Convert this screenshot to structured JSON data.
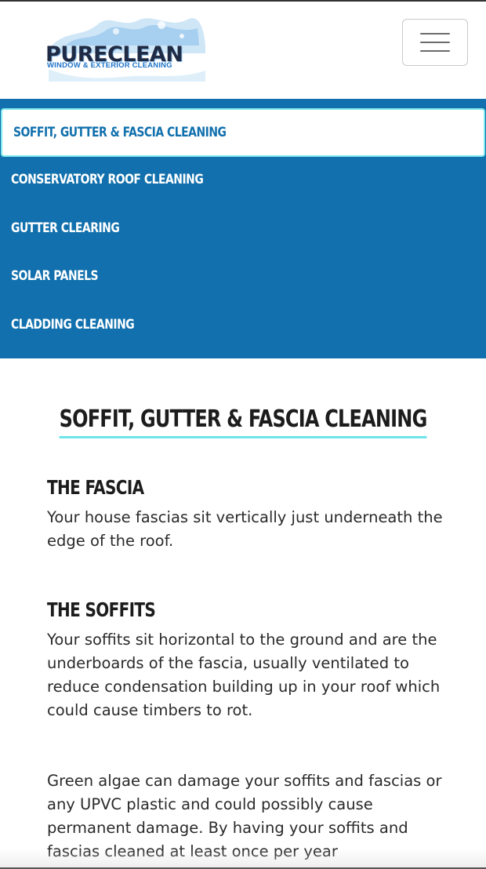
{
  "brand": {
    "name": "PURECLEAN",
    "tagline": "WINDOW & EXTERIOR CLEANING",
    "colors": {
      "primary": "#1170ad",
      "accent": "#6ee5ea",
      "text": "#1c1c1c"
    }
  },
  "header": {
    "menu_icon": "hamburger-icon"
  },
  "nav": {
    "items": [
      {
        "label": "Soffit, Gutter & Fascia Cleaning",
        "active": true
      },
      {
        "label": "Conservatory Roof Cleaning",
        "active": false
      },
      {
        "label": "Gutter Clearing",
        "active": false
      },
      {
        "label": "Solar Panels",
        "active": false
      },
      {
        "label": "Cladding Cleaning",
        "active": false
      }
    ]
  },
  "main": {
    "title": "Soffit, Gutter & Fascia Cleaning",
    "sections": [
      {
        "heading": "The Fascia",
        "body": "Your house fascias sit vertically just underneath the edge of the roof."
      },
      {
        "heading": "The Soffits",
        "body": "Your soffits sit horizontal to the ground and are the underboards of the fascia, usually ventilated to reduce condensation building up in your roof which could cause timbers to rot."
      }
    ],
    "paragraph": "Green algae can damage your soffits and fascias or any UPVC plastic and could possibly cause permanent damage. By having your soffits and fascias cleaned at least once per year"
  }
}
